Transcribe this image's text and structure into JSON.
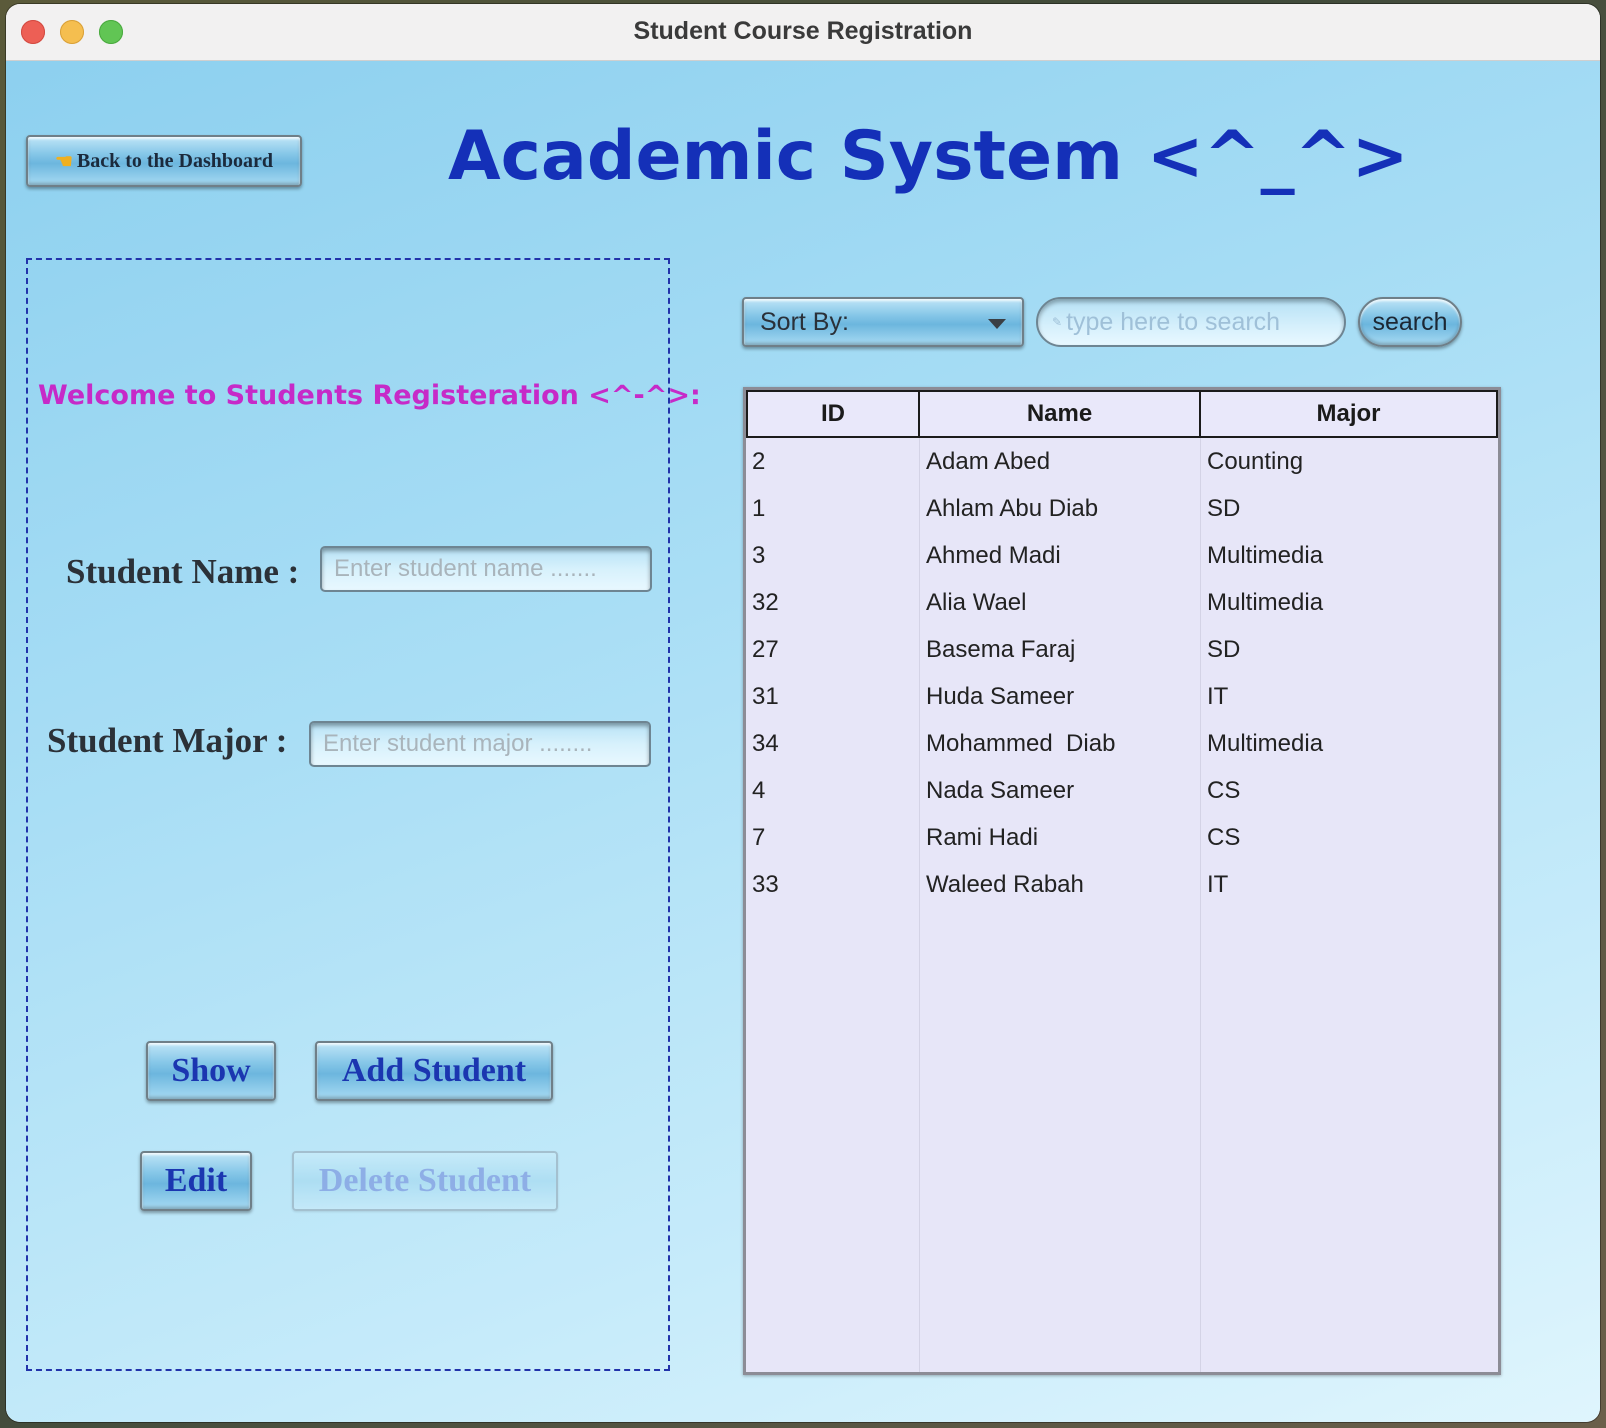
{
  "window": {
    "title": "Student Course Registration"
  },
  "header": {
    "back_button_label": "Back to the Dashboard",
    "app_title": "Academic System <^_^>"
  },
  "form": {
    "welcome": "Welcome to Students Registeration <^-^>:",
    "name_label": "Student Name :",
    "name_placeholder": "Enter student name .......",
    "name_value": "",
    "major_label": "Student Major :",
    "major_placeholder": "Enter student major ........",
    "major_value": "",
    "buttons": {
      "show": "Show",
      "add": "Add Student",
      "edit": "Edit",
      "delete": "Delete Student"
    }
  },
  "toolbar": {
    "sort_label": "Sort By:",
    "search_placeholder": "type here to search",
    "search_button": "search"
  },
  "table": {
    "columns": [
      "ID",
      "Name",
      "Major"
    ],
    "rows": [
      [
        "2",
        "Adam Abed",
        "Counting"
      ],
      [
        "1",
        "Ahlam Abu Diab",
        "SD"
      ],
      [
        "3",
        "Ahmed Madi",
        "Multimedia"
      ],
      [
        "32",
        "Alia Wael",
        "Multimedia"
      ],
      [
        "27",
        "Basema Faraj",
        "SD"
      ],
      [
        "31",
        "Huda Sameer",
        "IT"
      ],
      [
        "34",
        "Mohammed  Diab",
        "Multimedia"
      ],
      [
        "4",
        "Nada Sameer",
        "CS"
      ],
      [
        "7",
        "Rami Hadi",
        "CS"
      ],
      [
        "33",
        "Waleed Rabah",
        "IT"
      ]
    ]
  },
  "colors": {
    "title": "#1430b8",
    "welcome": "#c62ac8",
    "button_text": "#1b36b0",
    "table_bg": "#e7e6f8"
  }
}
